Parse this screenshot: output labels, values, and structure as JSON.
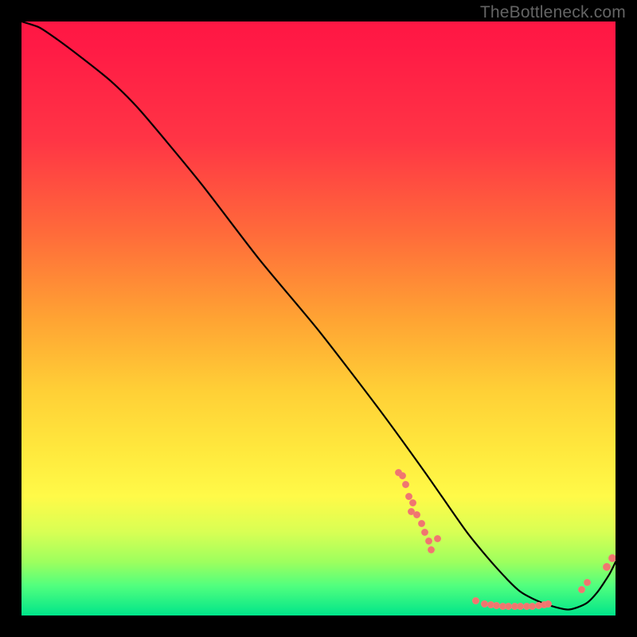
{
  "branding": {
    "watermark": "TheBottleneck.com"
  },
  "colors": {
    "point": "#f0766f",
    "curve": "#000000",
    "bg_top": "#ff1744",
    "bg_bottom": "#00e58a"
  },
  "chart_data": {
    "type": "line",
    "title": "",
    "xlabel": "",
    "ylabel": "",
    "xlim": [
      0,
      100
    ],
    "ylim": [
      0,
      100
    ],
    "grid": false,
    "series": [
      {
        "name": "curve",
        "x": [
          0,
          3,
          6,
          10,
          15,
          20,
          30,
          40,
          50,
          60,
          68,
          75,
          80,
          84,
          88,
          92,
          95,
          97,
          99,
          100
        ],
        "y": [
          100,
          99,
          97,
          94,
          90,
          85,
          73,
          60,
          48,
          35,
          24,
          14,
          8,
          4,
          2,
          1,
          2,
          4,
          7,
          9
        ]
      }
    ],
    "points": [
      {
        "x": 63.5,
        "y": 24.0
      },
      {
        "x": 64.1,
        "y": 23.5
      },
      {
        "x": 64.7,
        "y": 22.0
      },
      {
        "x": 65.2,
        "y": 20.0
      },
      {
        "x": 65.6,
        "y": 17.5
      },
      {
        "x": 65.9,
        "y": 19.0
      },
      {
        "x": 66.6,
        "y": 17.0
      },
      {
        "x": 67.3,
        "y": 15.5
      },
      {
        "x": 67.9,
        "y": 14.0
      },
      {
        "x": 68.5,
        "y": 12.5
      },
      {
        "x": 69.0,
        "y": 11.0
      },
      {
        "x": 70.0,
        "y": 13.0
      },
      {
        "x": 76.5,
        "y": 2.5
      },
      {
        "x": 78.0,
        "y": 2.0
      },
      {
        "x": 79.0,
        "y": 1.8
      },
      {
        "x": 80.0,
        "y": 1.7
      },
      {
        "x": 81.0,
        "y": 1.6
      },
      {
        "x": 82.0,
        "y": 1.5
      },
      {
        "x": 83.0,
        "y": 1.5
      },
      {
        "x": 84.0,
        "y": 1.5
      },
      {
        "x": 85.0,
        "y": 1.5
      },
      {
        "x": 86.0,
        "y": 1.6
      },
      {
        "x": 87.0,
        "y": 1.7
      },
      {
        "x": 88.0,
        "y": 1.8
      },
      {
        "x": 88.7,
        "y": 2.0
      },
      {
        "x": 94.3,
        "y": 4.3
      },
      {
        "x": 95.2,
        "y": 5.5
      },
      {
        "x": 98.5,
        "y": 8.2
      },
      {
        "x": 99.5,
        "y": 9.7
      }
    ]
  }
}
